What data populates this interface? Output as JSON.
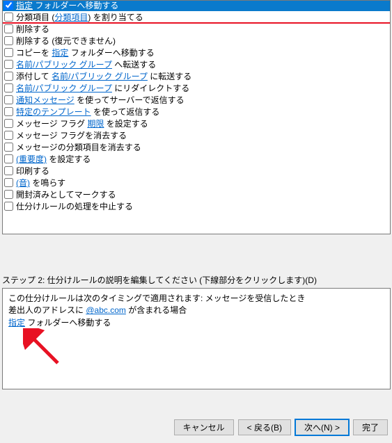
{
  "actions": [
    {
      "checked": true,
      "selected": true,
      "segments": [
        {
          "t": "link",
          "v": "指定"
        },
        {
          "t": "text",
          "v": " フォルダーへ移動する"
        }
      ]
    },
    {
      "checked": false,
      "segments": [
        {
          "t": "text",
          "v": "分類項目 ("
        },
        {
          "t": "link",
          "v": "分類項目"
        },
        {
          "t": "text",
          "v": ") を割り当てる"
        }
      ]
    },
    {
      "checked": false,
      "segments": [
        {
          "t": "text",
          "v": "削除する"
        }
      ]
    },
    {
      "checked": false,
      "segments": [
        {
          "t": "text",
          "v": "削除する (復元できません)"
        }
      ]
    },
    {
      "checked": false,
      "segments": [
        {
          "t": "text",
          "v": "コピーを "
        },
        {
          "t": "link",
          "v": "指定"
        },
        {
          "t": "text",
          "v": " フォルダーへ移動する"
        }
      ]
    },
    {
      "checked": false,
      "segments": [
        {
          "t": "link",
          "v": "名前/パブリック グループ"
        },
        {
          "t": "text",
          "v": " へ転送する"
        }
      ]
    },
    {
      "checked": false,
      "segments": [
        {
          "t": "text",
          "v": "添付して "
        },
        {
          "t": "link",
          "v": "名前/パブリック グループ"
        },
        {
          "t": "text",
          "v": " に転送する"
        }
      ]
    },
    {
      "checked": false,
      "segments": [
        {
          "t": "link",
          "v": "名前/パブリック グループ"
        },
        {
          "t": "text",
          "v": " にリダイレクトする"
        }
      ]
    },
    {
      "checked": false,
      "segments": [
        {
          "t": "link",
          "v": "通知メッセージ"
        },
        {
          "t": "text",
          "v": " を使ってサーバーで返信する"
        }
      ]
    },
    {
      "checked": false,
      "segments": [
        {
          "t": "link",
          "v": "特定のテンプレート"
        },
        {
          "t": "text",
          "v": " を使って返信する"
        }
      ]
    },
    {
      "checked": false,
      "segments": [
        {
          "t": "text",
          "v": "メッセージ フラグ "
        },
        {
          "t": "link",
          "v": "期限"
        },
        {
          "t": "text",
          "v": " を設定する"
        }
      ]
    },
    {
      "checked": false,
      "segments": [
        {
          "t": "text",
          "v": "メッセージ フラグを消去する"
        }
      ]
    },
    {
      "checked": false,
      "segments": [
        {
          "t": "text",
          "v": "メッセージの分類項目を消去する"
        }
      ]
    },
    {
      "checked": false,
      "segments": [
        {
          "t": "link",
          "v": "(重要度)"
        },
        {
          "t": "text",
          "v": " を設定する"
        }
      ]
    },
    {
      "checked": false,
      "segments": [
        {
          "t": "text",
          "v": "印刷する"
        }
      ]
    },
    {
      "checked": false,
      "segments": [
        {
          "t": "link",
          "v": "(音)"
        },
        {
          "t": "text",
          "v": " を鳴らす"
        }
      ]
    },
    {
      "checked": false,
      "segments": [
        {
          "t": "text",
          "v": "開封済みとしてマークする"
        }
      ]
    },
    {
      "checked": false,
      "segments": [
        {
          "t": "text",
          "v": "仕分けルールの処理を中止する"
        }
      ]
    }
  ],
  "step2": {
    "label": "ステップ 2: 仕分けルールの説明を編集してください (下線部分をクリックします)(D)",
    "line1": "この仕分けルールは次のタイミングで適用されます: メッセージを受信したとき",
    "line2_pre": "差出人のアドレスに ",
    "line2_link": "@abc.com",
    "line2_post": " が含まれる場合",
    "line3_link": "指定",
    "line3_post": " フォルダーへ移動する"
  },
  "buttons": {
    "cancel": "キャンセル",
    "back": "< 戻る(B)",
    "next": "次へ(N) >",
    "finish": "完了"
  }
}
